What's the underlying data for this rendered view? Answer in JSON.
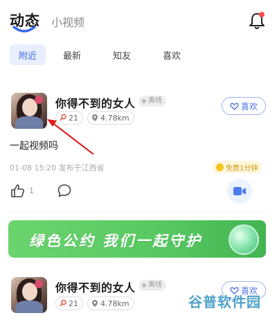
{
  "header": {
    "tab_active": "动态",
    "tab_secondary": "小视频"
  },
  "filters": [
    "附近",
    "最新",
    "知友",
    "喜欢"
  ],
  "posts": [
    {
      "name": "你得不到的女人",
      "status": "离线",
      "like_count_badge": "21",
      "distance": "4.78km",
      "follow_label": "喜欢",
      "text": "一起视频吗",
      "meta": "01-08 15:20 发布于江西省",
      "free_label": "免费1分钟",
      "likes": "1"
    },
    {
      "name": "你得不到的女人",
      "status": "离线",
      "like_count_badge": "21",
      "distance": "4.78km",
      "follow_label": "喜欢"
    }
  ],
  "banner": {
    "text": "绿色公约 我们一起守护"
  },
  "watermark": "谷普软件园",
  "colors": {
    "accent": "#3b66e6",
    "banner": "#58c862",
    "arrow": "#e02020"
  }
}
